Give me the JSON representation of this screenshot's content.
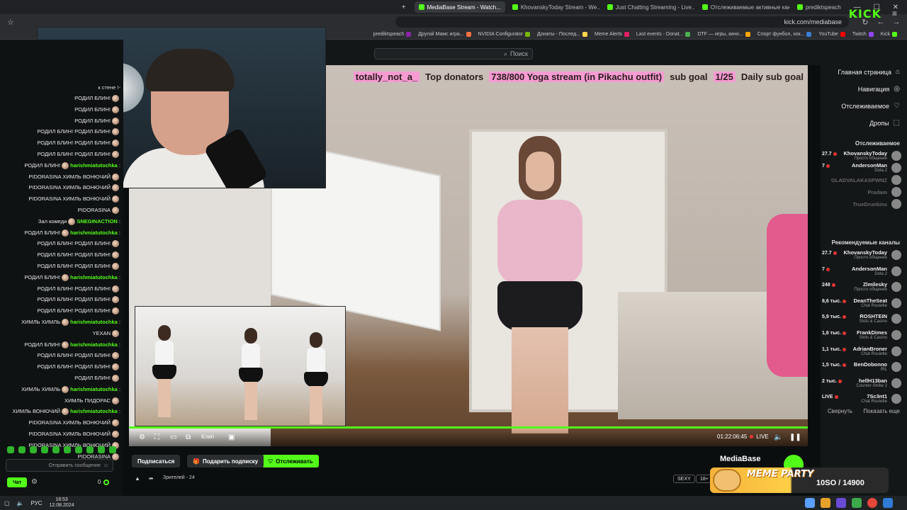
{
  "browser": {
    "tabs": [
      {
        "label": "prediktspeach",
        "active": false
      },
      {
        "label": "Отслеживаемые активные кан...",
        "active": false
      },
      {
        "label": "Just Chatting Streaming - Live...",
        "active": false
      },
      {
        "label": "KhovanskyToday Stream - We...",
        "active": false
      },
      {
        "label": "MediaBase Stream - Watch...",
        "active": true
      }
    ],
    "url": "kick.com/mediabase",
    "bookmarks": [
      "Kick",
      "Twitch",
      "YouTube",
      "Спорт фунбол, хок...",
      "DTF — игры, кино...",
      "Last events - Donat...",
      "Meme Alerts",
      "Донаты - Послед...",
      "NVIDIA Configurator",
      "Другой Мамс игра...",
      "prediktspeach"
    ]
  },
  "header": {
    "logo": "KICK",
    "search_placeholder": "Поиск"
  },
  "sidebar": {
    "nav": [
      {
        "label": "Главная страница",
        "icon": "home-icon"
      },
      {
        "label": "Навигация",
        "icon": "compass-icon"
      },
      {
        "label": "Отслеживаемое",
        "icon": "heart-icon"
      },
      {
        "label": "Дропы",
        "icon": "gift-icon"
      }
    ],
    "following_title": "Отслеживаемое",
    "following": [
      {
        "name": "KhovanskyToday",
        "category": "Просто общение",
        "viewers": "27.7",
        "live": true
      },
      {
        "name": "AndersonMan",
        "category": "Dota 2",
        "viewers": "7",
        "live": true
      },
      {
        "name": "GLADVALAKASPWNZ",
        "category": "",
        "viewers": "",
        "live": false
      },
      {
        "name": "Pradam",
        "category": "",
        "viewers": "",
        "live": false
      },
      {
        "name": "TrueDrunkins",
        "category": "",
        "viewers": "",
        "live": false
      }
    ],
    "recommended_title": "Рекомендуемые каналы",
    "recommended": [
      {
        "name": "KhovanskyToday",
        "category": "Просто общение",
        "viewers": "27.7"
      },
      {
        "name": "AndersonMan",
        "category": "Dota 2",
        "viewers": "7"
      },
      {
        "name": "Zlmilesky",
        "category": "Просто общение",
        "viewers": "248"
      },
      {
        "name": "DeanTheSeat",
        "category": "Chat Roulette",
        "viewers": "8,6 тыс."
      },
      {
        "name": "ROSHTEIN",
        "category": "Slots & Casino",
        "viewers": "5,9 тыс."
      },
      {
        "name": "FrankDimes",
        "category": "Slots & Casino",
        "viewers": "1,6 тыс."
      },
      {
        "name": "AdrianBroner",
        "category": "Chat Roulette",
        "viewers": "1,1 тыс."
      },
      {
        "name": "BenDobonno",
        "category": "IRL",
        "viewers": "1,5 тыс."
      },
      {
        "name": "hellH13ban",
        "category": "Counter-Strike 2",
        "viewers": "2 тыс."
      },
      {
        "name": "7Sc3nt1",
        "category": "Chat Roulette",
        "viewers": "LIVE"
      }
    ],
    "show_more": "Показать еще",
    "collapse": "Свернуть"
  },
  "stream": {
    "overlay_parts": [
      "Daily sub goal",
      "1/25",
      "sub goal",
      "738/800 Yoga stream (in Pikachu outfit)",
      "Top donators",
      "totally_not_a_"
    ],
    "time": "01:22:06:45",
    "live_label": "LIVE",
    "quality_label": "Клип",
    "streamer": "MediaBase",
    "follow_label": "Отслеживать",
    "gift_label": "Подарить подписку",
    "subscribe_label": "Подписаться",
    "tags": [
      "18+",
      "SEXY"
    ],
    "viewers_label": "Зрителей - 24",
    "meme_title": "MEME PARTY",
    "meme_goal": "10SO / 14900"
  },
  "chat": {
    "header_text": "к стене !-",
    "lines": [
      {
        "user": "",
        "text": "РОДИЛ БЛИН!"
      },
      {
        "user": "",
        "text": "РОДИЛ БЛИН!"
      },
      {
        "user": "",
        "text": "РОДИЛ БЛИН!"
      },
      {
        "user": "",
        "text": "РОДИЛ БЛИН! РОДИЛ БЛИН!"
      },
      {
        "user": "",
        "text": "РОДИЛ БЛИН! РОДИЛ БЛИН!"
      },
      {
        "user": "",
        "text": "РОДИЛ БЛИН! РОДИЛ БЛИН!"
      },
      {
        "user": "harishmiatutochka",
        "text": "РОДИЛ БЛИН!"
      },
      {
        "user": "",
        "text": "PIDORASINA ХИМЛЬ ВОНЮЧИЙ"
      },
      {
        "user": "",
        "text": "PIDORASINA ХИМЛЬ ВОНЮЧИЙ"
      },
      {
        "user": "",
        "text": "PIDORASINA ХИМЛЬ ВОНЮЧИЙ"
      },
      {
        "user": "",
        "text": "PIDORASINA"
      },
      {
        "user": "SNEGINACTION",
        "text": "Зал комеди"
      },
      {
        "user": "harishmiatutochka",
        "text": "РОДИЛ БЛИН!"
      },
      {
        "user": "",
        "text": "РОДИЛ БЛИН! РОДИЛ БЛИН!"
      },
      {
        "user": "",
        "text": "РОДИЛ БЛИН! РОДИЛ БЛИН!"
      },
      {
        "user": "",
        "text": "РОДИЛ БЛИН! РОДИЛ БЛИН!"
      },
      {
        "user": "harishmiatutochka",
        "text": "РОДИЛ БЛИН!"
      },
      {
        "user": "",
        "text": "РОДИЛ БЛИН! РОДИЛ БЛИН!"
      },
      {
        "user": "",
        "text": "РОДИЛ БЛИН! РОДИЛ БЛИН!"
      },
      {
        "user": "",
        "text": "РОДИЛ БЛИН! РОДИЛ БЛИН!"
      },
      {
        "user": "harishmiatutochka",
        "text": "ХИМЛЬ ХИМЛЬ"
      },
      {
        "user": "",
        "text": "YEXAN"
      },
      {
        "user": "harishmiatutochka",
        "text": "РОДИЛ БЛИН!"
      },
      {
        "user": "",
        "text": "РОДИЛ БЛИН! РОДИЛ БЛИН!"
      },
      {
        "user": "",
        "text": "РОДИЛ БЛИН! РОДИЛ БЛИН!"
      },
      {
        "user": "",
        "text": "РОДИЛ БЛИН!"
      },
      {
        "user": "harishmiatutochka",
        "text": "ХИМЛЬ ХИМЛЬ"
      },
      {
        "user": "",
        "text": "ХИМЛЬ ПИДОРАС"
      },
      {
        "user": "harishmiatutochka",
        "text": "ХИМЛЬ ВОНЮЧИЙ"
      },
      {
        "user": "",
        "text": "PIDORASINA ХИМЛЬ ВОНЮЧИЙ"
      },
      {
        "user": "",
        "text": "PIDORASINA ХИМЛЬ ВОНЮЧИЙ"
      },
      {
        "user": "",
        "text": "PIDORASINA ХИМЛЬ ВОНЮЧИЙ"
      },
      {
        "user": "",
        "text": "PIDORASINA"
      }
    ],
    "input_placeholder": "Отправить сообщение",
    "send_label": "Чат",
    "points": "0"
  },
  "taskbar": {
    "lang": "РУС",
    "time": "18:53",
    "date": "12.08.2024"
  },
  "colors": {
    "accent": "#53fc18",
    "bg": "#0b0e0f"
  }
}
